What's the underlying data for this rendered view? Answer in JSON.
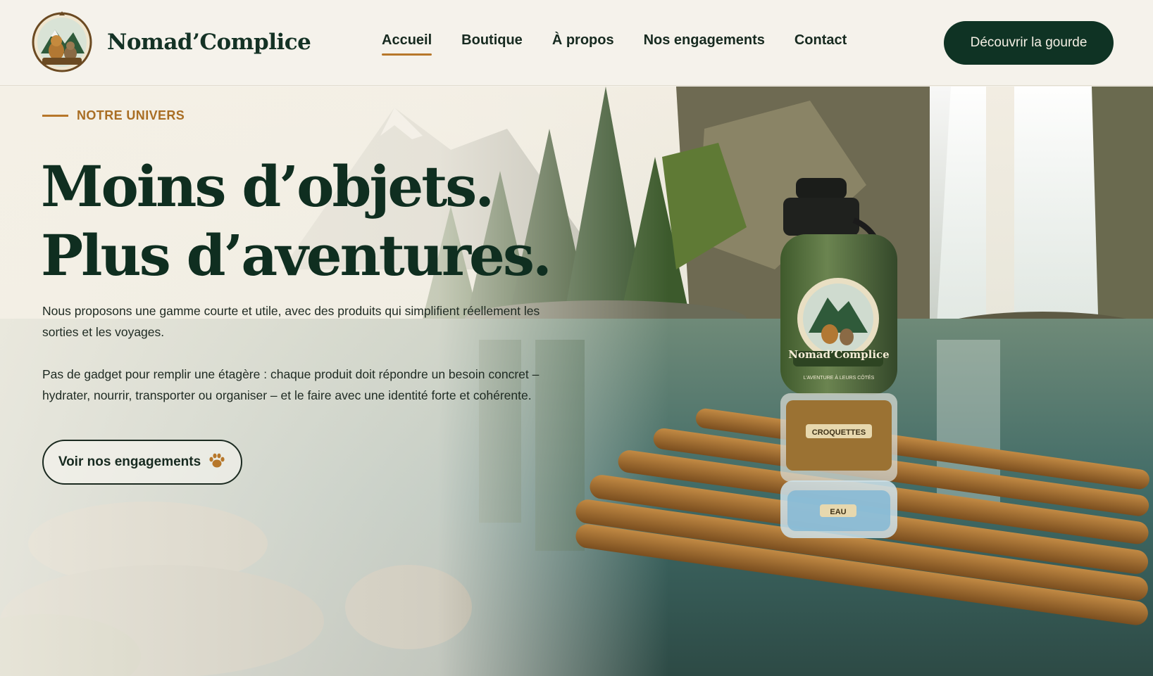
{
  "brand": {
    "name": "Nomad’Complice"
  },
  "nav": {
    "items": [
      {
        "label": "Accueil",
        "active": true
      },
      {
        "label": "Boutique",
        "active": false
      },
      {
        "label": "À propos",
        "active": false
      },
      {
        "label": "Nos engagements",
        "active": false
      },
      {
        "label": "Contact",
        "active": false
      }
    ]
  },
  "header": {
    "cta_label": "Découvrir la gourde"
  },
  "hero": {
    "eyebrow": "NOTRE UNIVERS",
    "headline_line1": "Moins d’objets.",
    "headline_line2": "Plus d’aventures.",
    "paragraph1": "Nous proposons une gamme courte et utile, avec des produits qui simplifient réellement les sorties et les voyages.",
    "paragraph2": "Pas de gadget pour remplir une étagère : chaque produit doit répondre un besoin concret – hydrater, nourrir, transporter ou organiser – et le faire avec une identité forte et cohérente.",
    "button_label": "Voir nos engagements",
    "button_icon": "paw-icon"
  },
  "product": {
    "bottle_brand": "Nomad’Complice",
    "tagline": "L’AVENTURE À LEURS CÔTÉS",
    "label_kibble": "CROQUETTES",
    "label_water": "EAU"
  },
  "colors": {
    "primary": "#0f3324",
    "accent": "#b7772a",
    "header_bg": "#f5f2eb"
  }
}
